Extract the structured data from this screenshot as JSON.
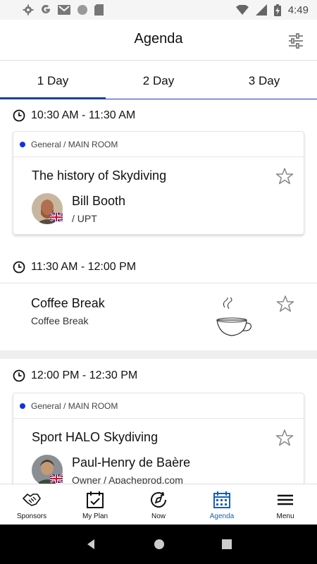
{
  "status_bar": {
    "time": "4:49",
    "left_icons": [
      "gear-icon",
      "google-icon",
      "gmail-icon",
      "circle-icon",
      "sd-card-icon"
    ],
    "right_icons": [
      "wifi-icon",
      "signal-icon",
      "battery-charging-icon"
    ]
  },
  "app_bar": {
    "title": "Agenda",
    "filter_icon": "tune-icon"
  },
  "tabs": [
    {
      "label": "1 Day",
      "active": true
    },
    {
      "label": "2 Day",
      "active": false
    },
    {
      "label": "3 Day",
      "active": false
    }
  ],
  "agenda": {
    "slots": [
      {
        "time": "10:30 AM - 11:30 AM",
        "room": "General / MAIN ROOM",
        "title": "The history of Skydiving",
        "speaker_name": "Bill Booth",
        "speaker_org": " / UPT"
      },
      {
        "time": "11:30 AM - 12:00 PM",
        "title": "Coffee Break",
        "subtitle": "Coffee Break"
      },
      {
        "time": "12:00 PM - 12:30 PM",
        "room": "General / MAIN ROOM",
        "title": "Sport HALO Skydiving",
        "speaker_name": "Paul-Henry de Baère",
        "speaker_org": "Owner / Apacheprod.com"
      }
    ]
  },
  "bottom_nav": [
    {
      "label": "Sponsors",
      "icon": "handshake-icon"
    },
    {
      "label": "My Plan",
      "icon": "calendar-check-icon"
    },
    {
      "label": "Now",
      "icon": "compass-icon"
    },
    {
      "label": "Agenda",
      "icon": "calendar-grid-icon",
      "active": true
    },
    {
      "label": "Menu",
      "icon": "menu-icon"
    }
  ],
  "colors": {
    "accent": "#1a3fa8",
    "active_nav": "#1a5fb4",
    "room_dot": "#1133dd",
    "background": "#efefef"
  }
}
